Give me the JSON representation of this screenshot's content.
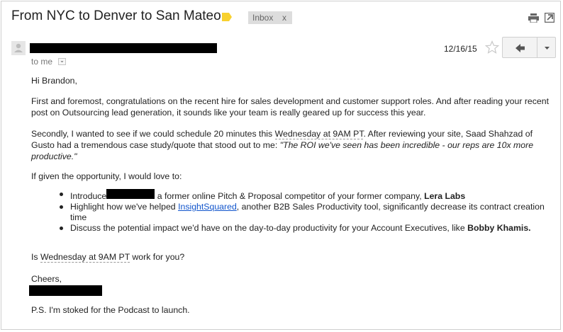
{
  "header": {
    "subject": "From NYC to Denver to San Mateo",
    "label_chip": "Inbox",
    "label_chip_close": "x"
  },
  "meta": {
    "to_me": "to me",
    "date": "12/16/15"
  },
  "body": {
    "greeting": "Hi Brandon,",
    "first": "First and foremost, congratulations on the recent hire for sales development and customer support roles. And after reading your recent post on Outsourcing lead generation, it sounds like your team is really geared up for success this year.",
    "second_a": "Secondly, I wanted to see if we could schedule 20 minutes this ",
    "second_time": "Wednesday at 9AM PT",
    "second_b": ". After reviewing your site, Saad Shahzad of Gusto had a tremendous case study/quote that stood out to me: ",
    "second_quote": "\"The ROI we've seen has been incredible - our reps are 10x more productive.\"",
    "given": "If given the opportunity, I would love to:",
    "bullet1_a": "Introduce",
    "bullet1_b": " a former online Pitch & Proposal competitor of your former company, ",
    "bullet1_bold": "Lera Labs",
    "bullet2_a": "Highlight how we've helped ",
    "bullet2_link": "InsightSquared",
    "bullet2_b": ", another B2B Sales Productivity tool, significantly decrease its contract creation time",
    "bullet3_a": "Discuss the potential impact we'd have on the day-to-day productivity for your Account Executives, like ",
    "bullet3_bold": "Bobby Khamis.",
    "ask_time": "Wednesday at 9AM PT",
    "ask_rest": " work for you?",
    "cheers": "Cheers,",
    "ps": "P.S. I'm stoked for the Podcast to launch."
  },
  "colors": {
    "label_tag": "#f8d12f",
    "link": "#1155cc",
    "redaction": "#000000"
  },
  "icons": [
    "label-tag-icon",
    "print-icon",
    "new-window-icon",
    "avatar-icon",
    "star-icon",
    "reply-icon",
    "chevron-down-icon"
  ]
}
